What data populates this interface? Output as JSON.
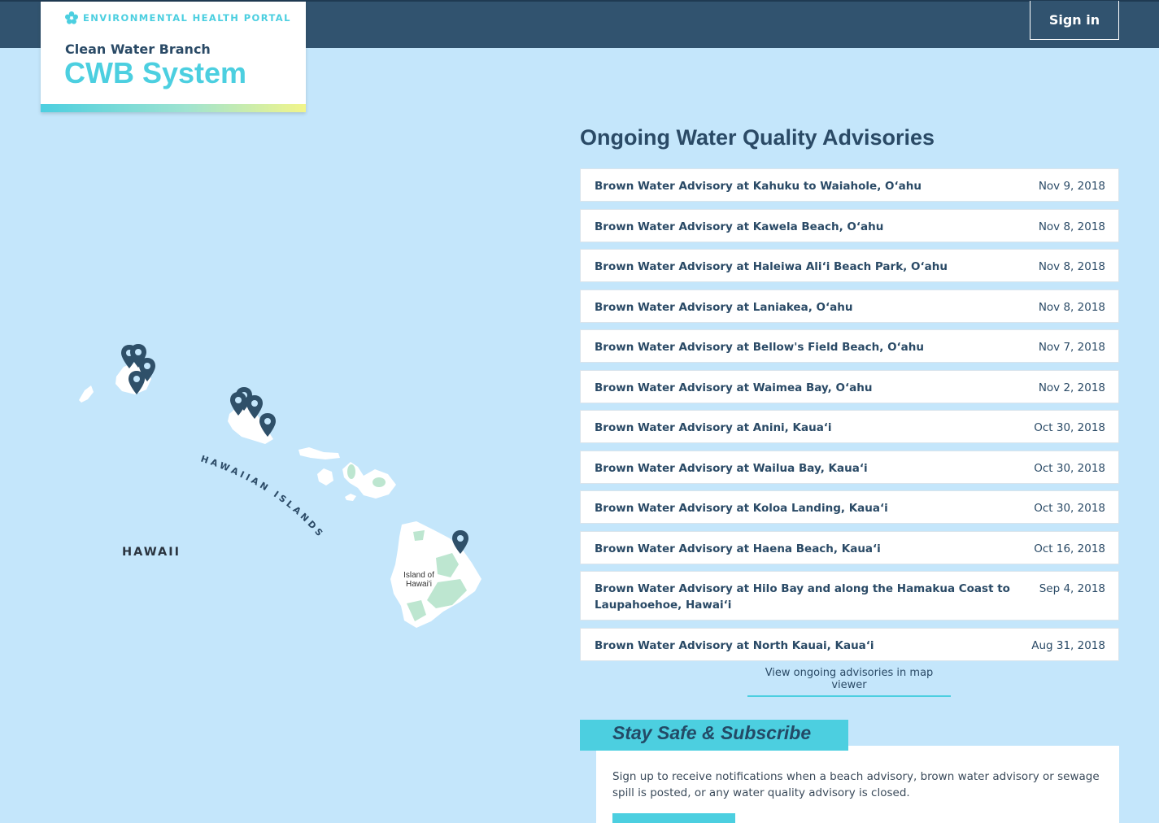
{
  "header": {
    "portal_label": "ENVIRONMENTAL HEALTH PORTAL",
    "branch": "Clean Water Branch",
    "system_title": "CWB System",
    "signin_label": "Sign in"
  },
  "map": {
    "state_label": "HAWAII",
    "chain_label": "HAWAIIAN ISLANDS",
    "island_label_line1": "Island of",
    "island_label_line2": "Hawai'i"
  },
  "advisories": {
    "heading": "Ongoing Water Quality Advisories",
    "items": [
      {
        "title": "Brown Water Advisory at Kahuku to Waiahole, O‘ahu",
        "date": "Nov 9, 2018"
      },
      {
        "title": "Brown Water Advisory at Kawela Beach, O‘ahu",
        "date": "Nov 8, 2018"
      },
      {
        "title": "Brown Water Advisory at Haleiwa Ali‘i Beach Park, O‘ahu",
        "date": "Nov 8, 2018"
      },
      {
        "title": "Brown Water Advisory at Laniakea, O‘ahu",
        "date": "Nov 8, 2018"
      },
      {
        "title": "Brown Water Advisory at Bellow's Field Beach, O‘ahu",
        "date": "Nov 7, 2018"
      },
      {
        "title": "Brown Water Advisory at Waimea Bay, O‘ahu",
        "date": "Nov 2, 2018"
      },
      {
        "title": "Brown Water Advisory at Anini, Kaua‘i",
        "date": "Oct 30, 2018"
      },
      {
        "title": "Brown Water Advisory at Wailua Bay, Kaua‘i",
        "date": "Oct 30, 2018"
      },
      {
        "title": "Brown Water Advisory at Koloa Landing, Kaua‘i",
        "date": "Oct 30, 2018"
      },
      {
        "title": "Brown Water Advisory at Haena Beach, Kaua‘i",
        "date": "Oct 16, 2018"
      },
      {
        "title": "Brown Water Advisory at Hilo Bay and along the Hamakua Coast to Laupahoehoe, Hawai‘i",
        "date": "Sep 4, 2018"
      },
      {
        "title": "Brown Water Advisory at North Kauai, Kaua‘i",
        "date": "Aug 31, 2018"
      }
    ],
    "map_link": "View ongoing advisories in map viewer"
  },
  "subscribe": {
    "heading": "Stay Safe & Subscribe",
    "text": "Sign up to receive notifications when a beach advisory, brown water advisory or sewage spill is posted, or any water quality advisory is closed."
  },
  "colors": {
    "topbar": "#31536f",
    "accent": "#4ccfe0",
    "background": "#c4e6fb",
    "marker": "#2f5069"
  },
  "icons": [
    "hibiscus-icon",
    "map-marker-icon"
  ]
}
